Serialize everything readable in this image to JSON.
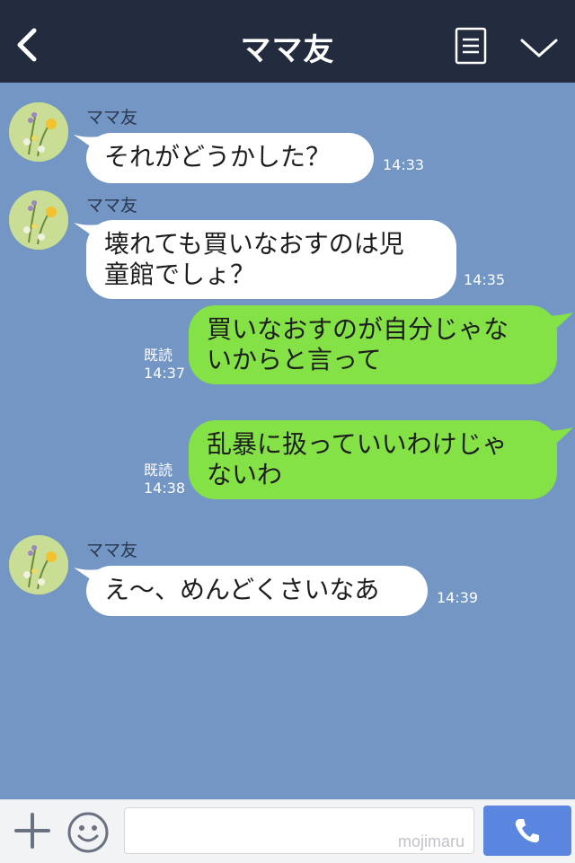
{
  "header": {
    "title": "ママ友"
  },
  "chat": {
    "incoming_name": "ママ友",
    "messages": [
      {
        "dir": "in",
        "lines": [
          "それがどうかした？"
        ],
        "time": "14:33"
      },
      {
        "dir": "in",
        "lines": [
          "壊れても買いなおすのは児",
          "童館でしょ？"
        ],
        "time": "14:35"
      },
      {
        "dir": "out",
        "lines": [
          "買いなおすのが自分じゃな",
          "いからと言って"
        ],
        "read": "既読",
        "time": "14:37"
      },
      {
        "dir": "out",
        "lines": [
          "乱暴に扱っていいわけじゃ",
          "ないわ"
        ],
        "read": "既読",
        "time": "14:38"
      },
      {
        "dir": "in",
        "lines": [
          "え〜、めんどくさいなあ"
        ],
        "time": "14:39"
      }
    ]
  },
  "footer": {
    "input_value": "",
    "watermark": "mojimaru"
  },
  "colors": {
    "header_bg": "#232c3f",
    "chat_bg": "#7396c4",
    "incoming_bubble": "#ffffff",
    "outgoing_bubble": "#84e246",
    "send_button": "#5a86e0"
  },
  "icons": {
    "back": "chevron-left-icon",
    "menu": "list-icon",
    "more": "chevron-down-icon",
    "add": "plus-icon",
    "emoji": "smile-icon",
    "call": "phone-icon",
    "avatar": "flower-avatar"
  }
}
